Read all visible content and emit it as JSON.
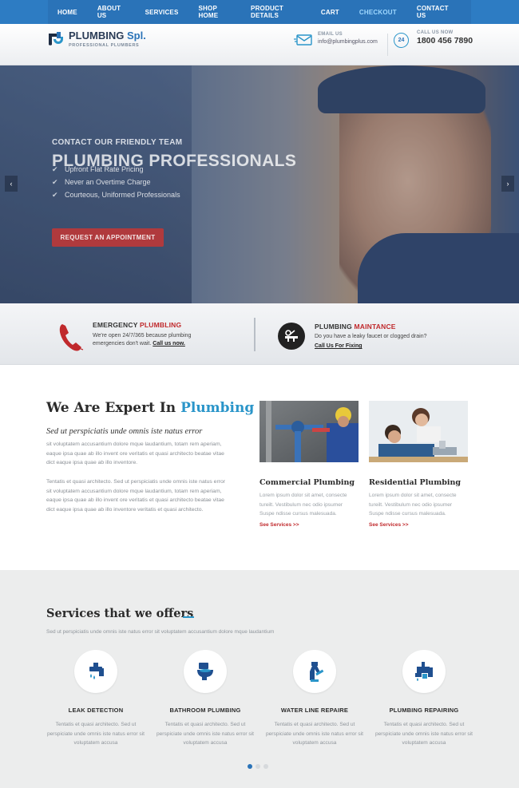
{
  "nav": {
    "items": [
      {
        "label": "HOME"
      },
      {
        "label": "ABOUT US"
      },
      {
        "label": "SERVICES"
      },
      {
        "label": "SHOP HOME"
      },
      {
        "label": "PRODUCT DETAILS"
      },
      {
        "label": "CART"
      },
      {
        "label": "CHECKOUT"
      },
      {
        "label": "CONTACT US"
      }
    ],
    "active": "CHECKOUT"
  },
  "header": {
    "brand": "PLUMBING",
    "brand_accent": "Spl.",
    "tagline": "PROFESSIONAL PLUMBERS",
    "email_label": "EMAIL US",
    "email_value": "info@plumbingplus.com",
    "phone_badge": "24",
    "phone_label": "CALL US NOW",
    "phone_value": "1800 456 7890"
  },
  "hero": {
    "kicker": "CONTACT OUR FRIENDLY TEAM",
    "title": "PLUMBING PROFESSIONALS",
    "bullets": [
      "Upfront Flat Rate Pricing",
      "Never an Overtime Charge",
      "Courteous, Uniformed Professionals"
    ],
    "button": "REQUEST AN APPOINTMENT",
    "prev": "‹",
    "next": "›"
  },
  "strip": {
    "emergency": {
      "title_main": "EMERGENCY",
      "title_accent": "PLUMBLING",
      "text": "We're open 24/7/365 because plumbing",
      "text2": "emergencies don't wait.",
      "link": "Call us now."
    },
    "maintance": {
      "title_main": "PLUMBING",
      "title_accent": "MAINTANCE",
      "text": "Do you have a leaky faucet or clogged drain?",
      "link": "Call Us For Fixing"
    }
  },
  "expert": {
    "title_main": "We Are Expert In",
    "title_accent": "Plumbing",
    "subtitle": "Sed ut perspiciatis unde omnis iste natus error",
    "p1": "sit voluptatem accusantium dolore mque laudantium, totam rem aperiam, eaque ipsa quae ab illo invent ore veritatis et quasi architecto beatae vitae dict eaque ipsa quae ab illo inventore.",
    "p2": "Tentatis et quasi architecto. Sed ut perspiciatis unde omnis iste natus error sit voluptatem accusantium dolore mque laudantium, totam rem aperiam, eaque ipsa quae ab illo invent ore veritatis et quasi architecto beatae vitae dict eaque ipsa quae ab illo inventore veritatis et quasi architecto."
  },
  "cards": [
    {
      "title": "Commercial Plumbing",
      "text": "Lorem ipsum dolor sit amet, consecte tureilt. Vestibulum nec odio ipsumer Suspe ndisse cursus malesuada.",
      "link": "See Services >>"
    },
    {
      "title": "Residential Plumbing",
      "text": "Lorem ipsum dolor sit amet, consecte tureilt. Vestibulum nec odio ipsumer Suspe ndisse cursus malesuada.",
      "link": "See Services >>"
    }
  ],
  "offers": {
    "title": "Services that we offers",
    "subtitle": "Sed ut perspiciatis unde omnis iste natus error sit voluptatem accusantium dolore mque laudantium",
    "items": [
      {
        "title": "LEAK DETECTION",
        "text": "Tentatis et quasi architecto. Sed ut perspiciate unde omnis iste natus error sit voluptatem accusa",
        "icon": "leak-icon"
      },
      {
        "title": "BATHROOM PLUMBING",
        "text": "Tentatis et quasi architecto. Sed ut perspiciate unde omnis iste natus error sit voluptatem accusa",
        "icon": "toilet-icon"
      },
      {
        "title": "WATER LINE REPAIRE",
        "text": "Tentatis et quasi architecto. Sed ut perspiciate unde omnis iste natus error sit voluptatem accusa",
        "icon": "pipe-icon"
      },
      {
        "title": "PLUMBING REPAIRING",
        "text": "Tentatis et quasi architecto. Sed ut perspiciate unde omnis iste natus error sit voluptatem accusa",
        "icon": "valve-icon"
      }
    ]
  },
  "colors": {
    "nav": "#2a73b8",
    "accent_red": "#c0292c",
    "accent_blue": "#2a95c9"
  }
}
